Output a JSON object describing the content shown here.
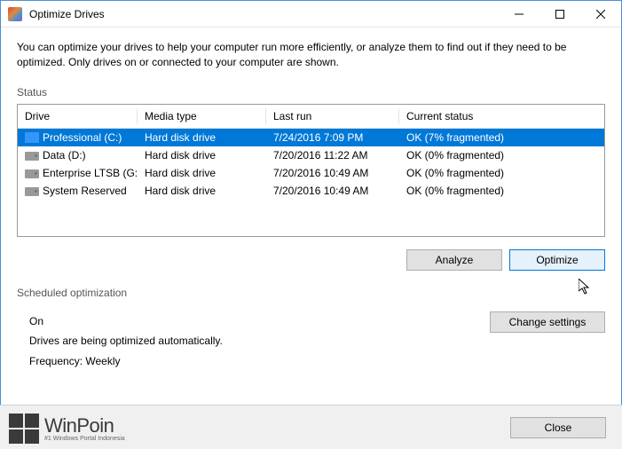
{
  "window": {
    "title": "Optimize Drives"
  },
  "intro": "You can optimize your drives to help your computer run more efficiently, or analyze them to find out if they need to be optimized. Only drives on or connected to your computer are shown.",
  "status_label": "Status",
  "columns": {
    "drive": "Drive",
    "media": "Media type",
    "run": "Last run",
    "status": "Current status"
  },
  "drives": [
    {
      "icon": "win",
      "name": "Professional (C:)",
      "media": "Hard disk drive",
      "run": "7/24/2016 7:09 PM",
      "status": "OK (7% fragmented)",
      "selected": true
    },
    {
      "icon": "hdd",
      "name": "Data (D:)",
      "media": "Hard disk drive",
      "run": "7/20/2016 11:22 AM",
      "status": "OK (0% fragmented)",
      "selected": false
    },
    {
      "icon": "hdd",
      "name": "Enterprise LTSB (G:)",
      "media": "Hard disk drive",
      "run": "7/20/2016 10:49 AM",
      "status": "OK (0% fragmented)",
      "selected": false
    },
    {
      "icon": "hdd",
      "name": "System Reserved",
      "media": "Hard disk drive",
      "run": "7/20/2016 10:49 AM",
      "status": "OK (0% fragmented)",
      "selected": false
    }
  ],
  "buttons": {
    "analyze": "Analyze",
    "optimize": "Optimize",
    "change": "Change settings",
    "close": "Close"
  },
  "schedule": {
    "label": "Scheduled optimization",
    "state": "On",
    "desc": "Drives are being optimized automatically.",
    "freq": "Frequency: Weekly"
  },
  "watermark": {
    "name": "WinPoin",
    "tag": "#1 Windows Portal Indonesia"
  }
}
